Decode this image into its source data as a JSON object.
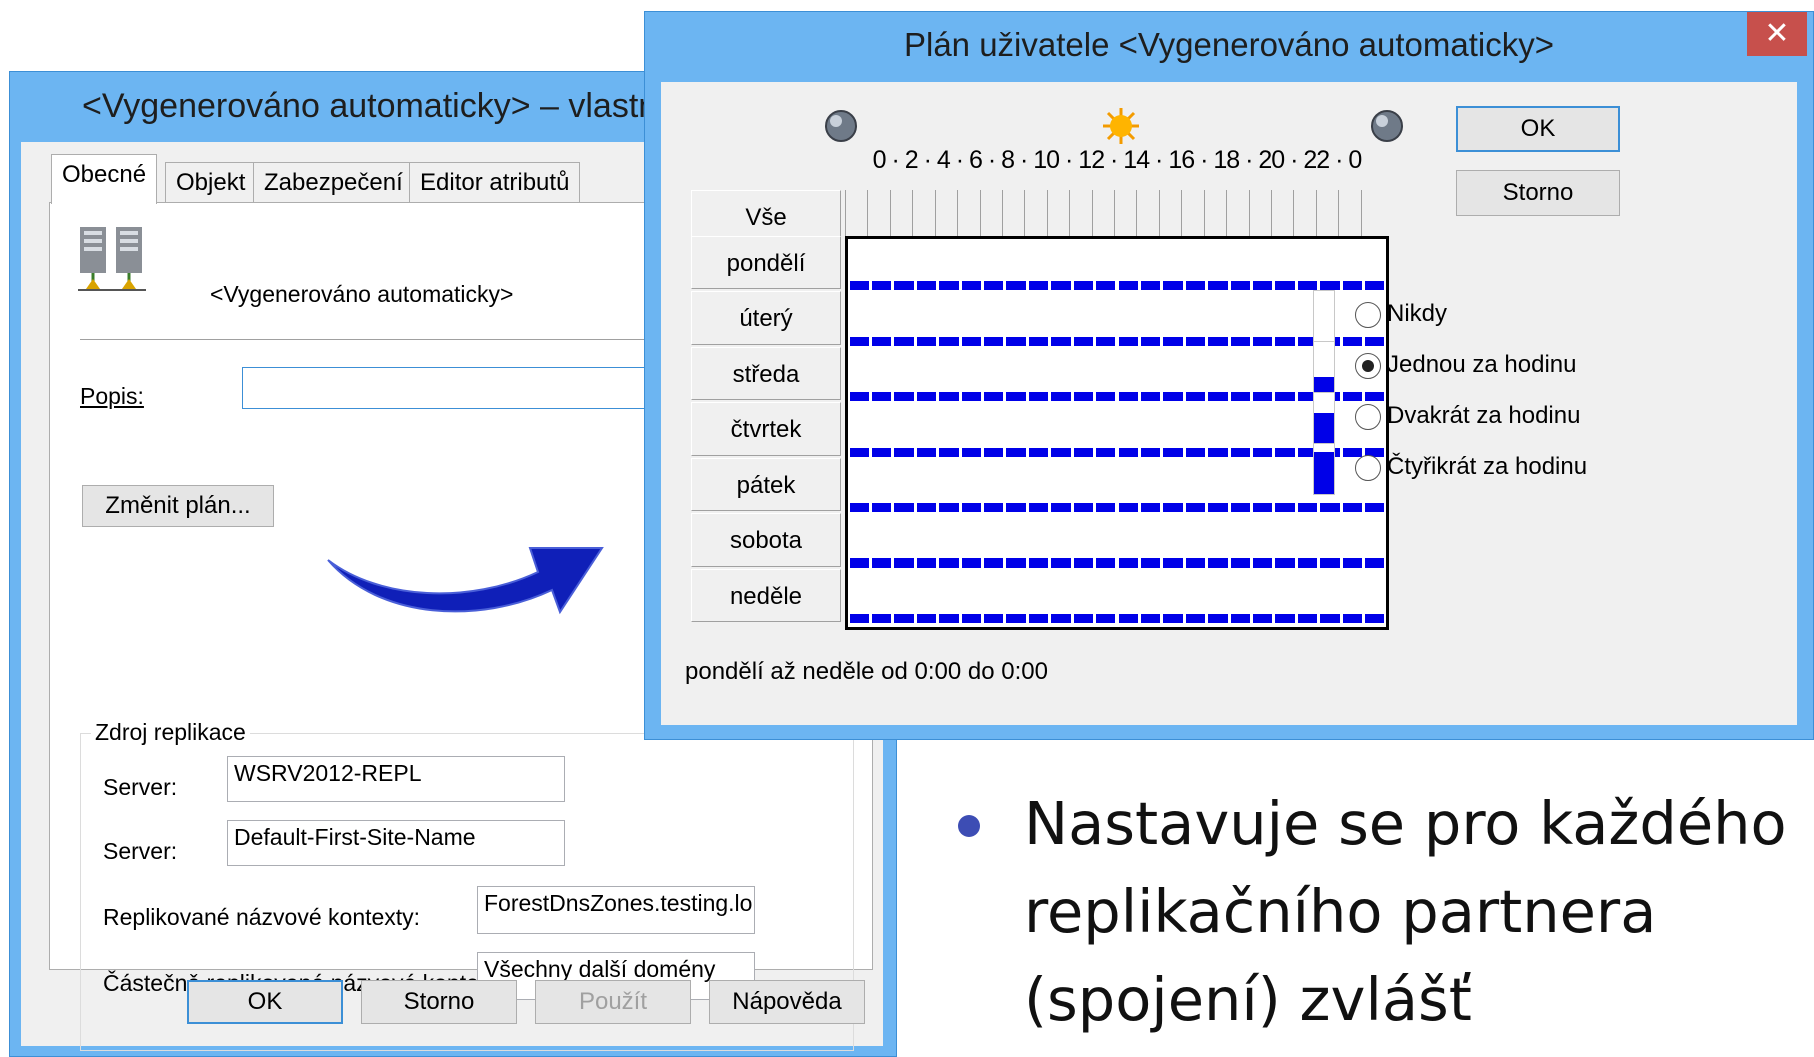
{
  "props_window": {
    "title": "<Vygenerováno automaticky> – vlastnosti",
    "tabs": [
      "Obecné",
      "Objekt",
      "Zabezpečení",
      "Editor atributů"
    ],
    "object_name": "<Vygenerováno automaticky>",
    "description_label": "Popis:",
    "description_value": "",
    "change_schedule_button": "Změnit plán...",
    "group_title": "Zdroj replikace",
    "server_label_1": "Server:",
    "server_value_1": "WSRV2012-REPL",
    "server_label_2": "Server:",
    "server_value_2": "Default-First-Site-Name",
    "replicated_contexts_label": "Replikované názvové kontexty:",
    "replicated_contexts_value": "ForestDnsZones.testing.lo",
    "partial_contexts_label": "Částečně replikované názvové kontexty:",
    "partial_contexts_value": "Všechny další domény",
    "buttons": {
      "ok": "OK",
      "cancel": "Storno",
      "apply": "Použít",
      "help": "Nápověda"
    }
  },
  "schedule_window": {
    "title": "Plán uživatele <Vygenerováno automaticky>",
    "close_glyph": "✕",
    "hour_scale": "0 · 2 · 4 · 6 · 8 · 10 · 12 · 14 · 16 · 18 · 20 · 22 · 0",
    "all_label": "Vše",
    "days": [
      "pondělí",
      "úterý",
      "středa",
      "čtvrtek",
      "pátek",
      "sobota",
      "neděle"
    ],
    "hours_per_day": 24,
    "schedule_level": "Jednou za hodinu",
    "ok_button": "OK",
    "cancel_button": "Storno",
    "options": [
      {
        "label": "Nikdy",
        "selected": false,
        "fill_fraction": 0
      },
      {
        "label": "Jednou za hodinu",
        "selected": true,
        "fill_fraction": 0.3
      },
      {
        "label": "Dvakrát za hodinu",
        "selected": false,
        "fill_fraction": 0.6
      },
      {
        "label": "Čtyřikrát za hodinu",
        "selected": false,
        "fill_fraction": 0.85
      }
    ],
    "status_text": "pondělí až neděle od 0:00 do 0:00",
    "cell_color": "#0000e8"
  },
  "slide": {
    "bullet": "Nastavuje se pro každého replikačního partnera (spojení) zvlášť"
  },
  "colors": {
    "window_frame": "#6cb5f2",
    "arrow": "#0f1fb8",
    "bullet_dot": "#3d4db4"
  }
}
